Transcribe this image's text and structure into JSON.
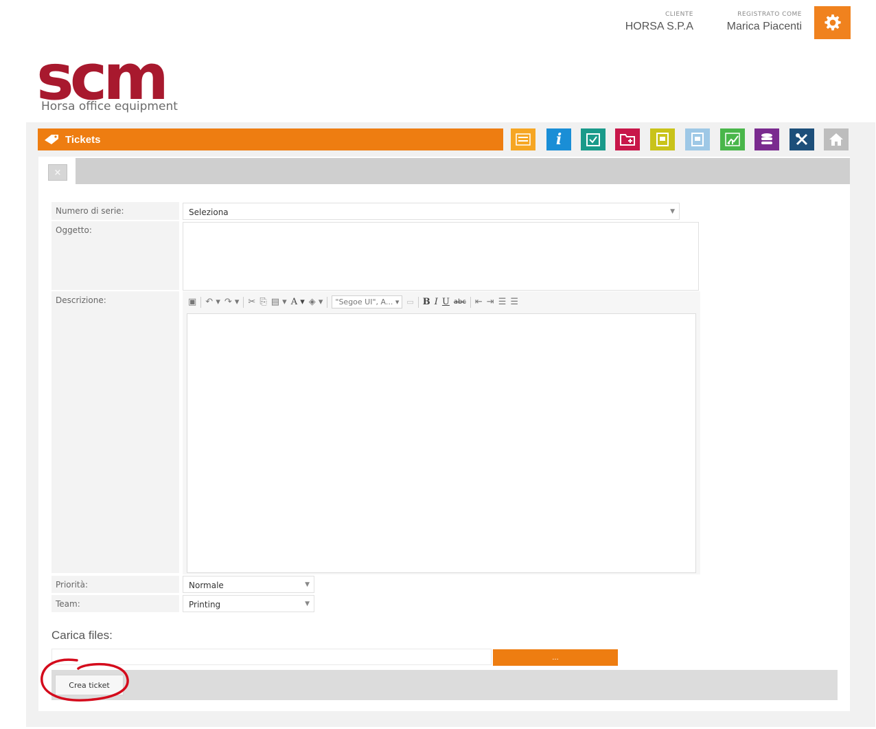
{
  "header": {
    "client_label": "CLIENTE",
    "client_value": "HORSA S.P.A",
    "user_label": "REGISTRATO COME",
    "user_value": "Marica Piacenti"
  },
  "logo": {
    "text": "scm",
    "subtitle": "Horsa office equipment"
  },
  "page": {
    "title": "Tickets"
  },
  "toolbar_icons": [
    {
      "name": "list-icon",
      "color": "#f6a623"
    },
    {
      "name": "info-icon",
      "color": "#1a8ed6"
    },
    {
      "name": "checklist-icon",
      "color": "#1a9a8a"
    },
    {
      "name": "folder-add-icon",
      "color": "#c8174a"
    },
    {
      "name": "document-icon",
      "color": "#c9c31a"
    },
    {
      "name": "form-icon",
      "color": "#9ec8e6"
    },
    {
      "name": "chart-icon",
      "color": "#49b64a"
    },
    {
      "name": "database-icon",
      "color": "#7a2b8f"
    },
    {
      "name": "tools-icon",
      "color": "#1d4f7a"
    },
    {
      "name": "home-icon",
      "color": "#bdbdbd"
    }
  ],
  "form": {
    "serial_label": "Numero di serie:",
    "serial_value": "Seleziona",
    "subject_label": "Oggetto:",
    "description_label": "Descrizione:",
    "editor_font": "\"Segoe UI\", A...",
    "priority_label": "Priorità:",
    "priority_value": "Normale",
    "team_label": "Team:",
    "team_value": "Printing"
  },
  "upload": {
    "label": "Carica files:",
    "button": "..."
  },
  "actions": {
    "create": "Crea ticket"
  },
  "colors": {
    "accent": "#ee7d11",
    "logo_red": "#a8192e",
    "annotation": "#d40b1c"
  }
}
